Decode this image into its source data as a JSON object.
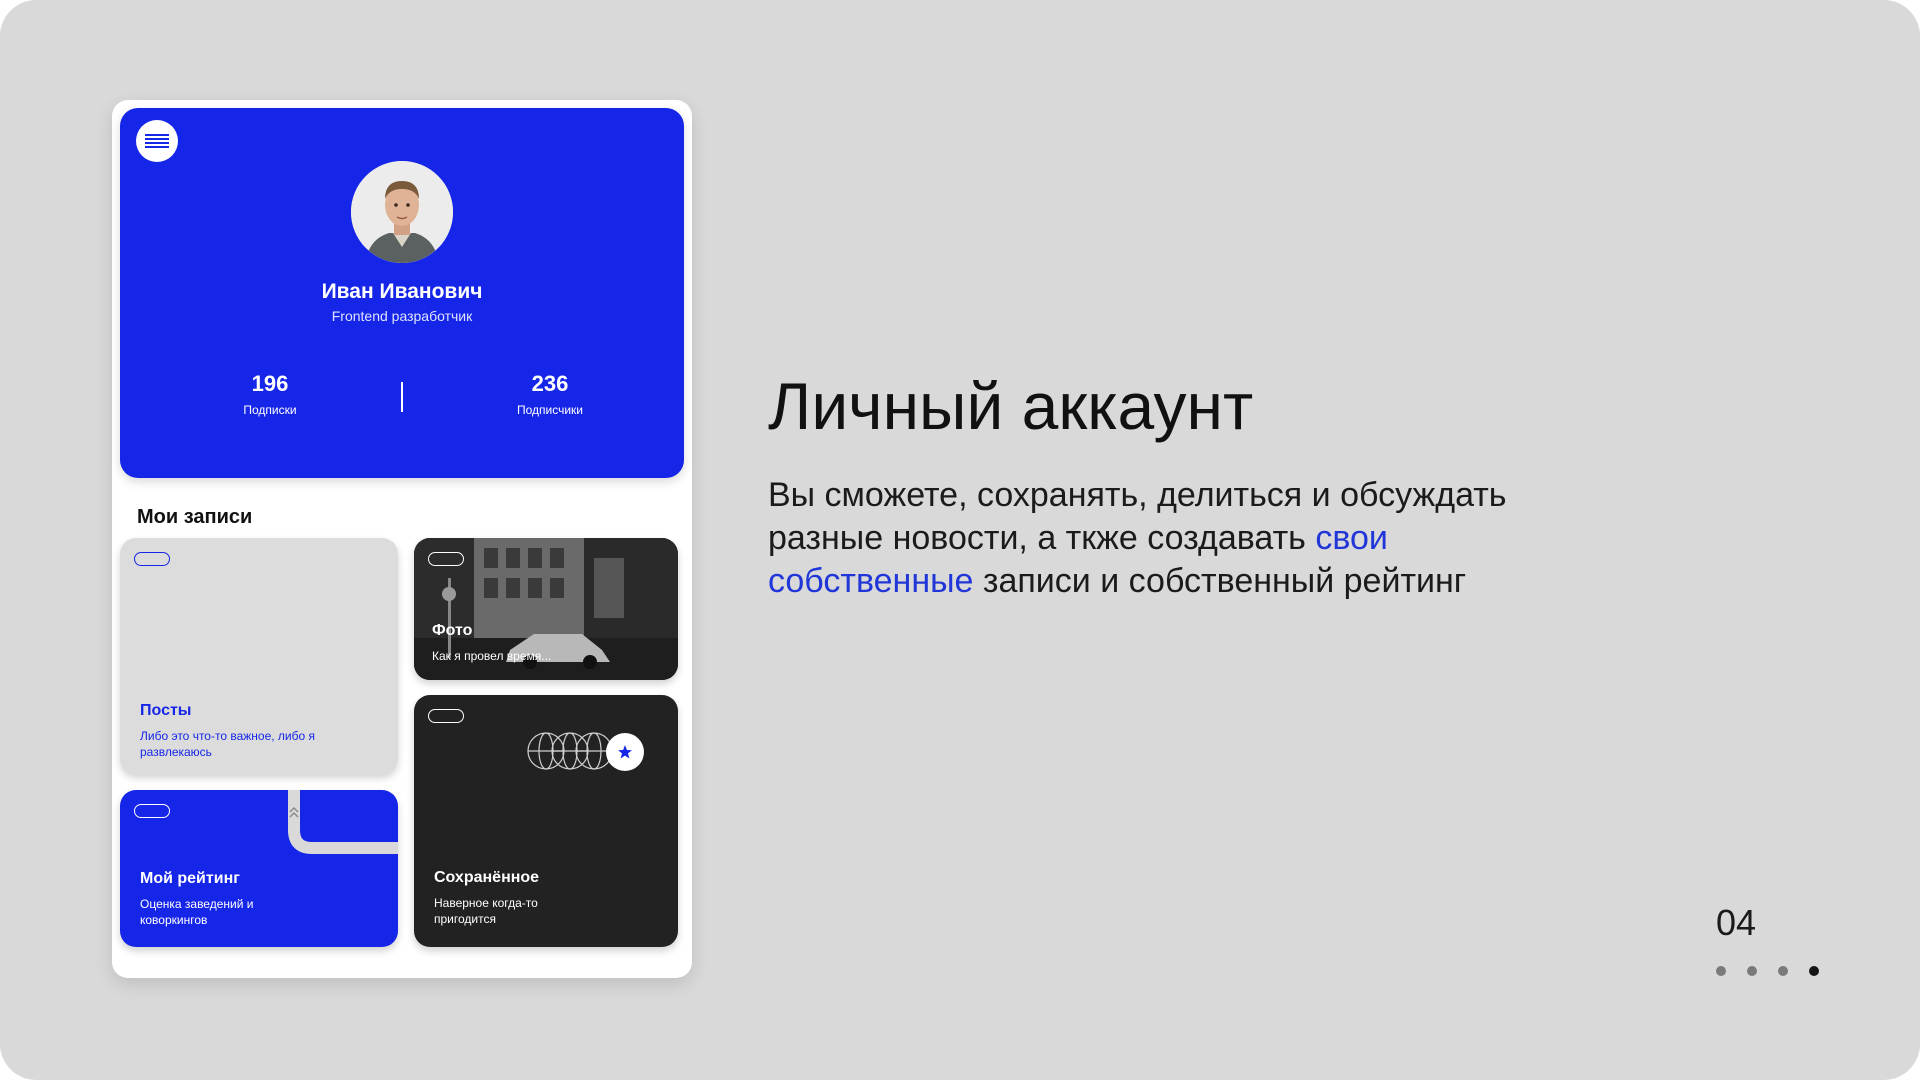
{
  "colors": {
    "accent_blue": "#1626e8",
    "link_blue": "#2036d8",
    "dark_card": "#222222",
    "background": "#d9d9d9"
  },
  "profile": {
    "name": "Иван Иванович",
    "role": "Frontend разработчик",
    "stats": [
      {
        "value": "196",
        "label": "Подписки"
      },
      {
        "value": "236",
        "label": "Подписчики"
      }
    ]
  },
  "section_title": "Мои записи",
  "cards": {
    "posts": {
      "title": "Посты",
      "desc": "Либо это что-то важное, либо я развлекаюсь"
    },
    "photo": {
      "title": "Фото",
      "desc": "Как я провел время..."
    },
    "rating": {
      "title": "Мой рейтинг",
      "desc": "Оценка заведений и коворкингов"
    },
    "saved": {
      "title": "Сохранённое",
      "desc": "Наверное когда-то пригодится"
    }
  },
  "slide": {
    "heading": "Личный аккаунт",
    "body_before": "Вы сможете, сохранять, делиться и обсуждать разные новости, а ткже создавать ",
    "body_accent": "свои собственные",
    "body_after": " записи и собственный рейтинг",
    "page_number": "04",
    "pagination": {
      "total": 4,
      "active": 4
    }
  },
  "icons": [
    "menu-icon",
    "avatar-photo",
    "chevron-up-icon",
    "star-icon",
    "globe-icon"
  ]
}
